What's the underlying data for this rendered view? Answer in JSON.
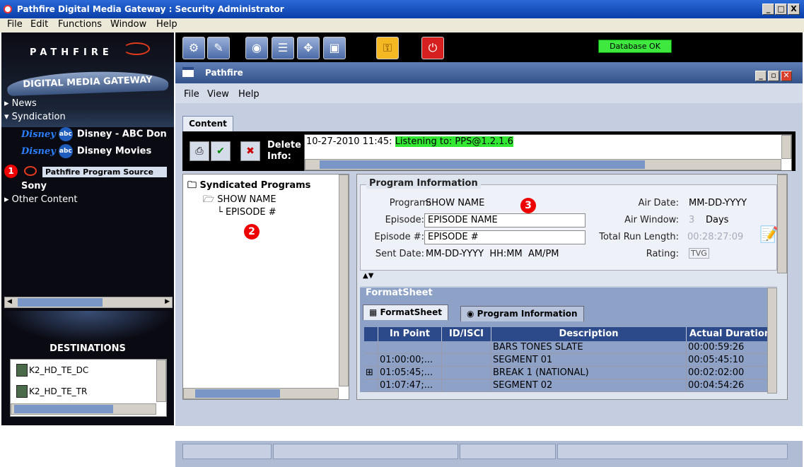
{
  "window": {
    "title": "Pathfire Digital Media Gateway : Security Administrator",
    "controls": [
      "_",
      "□",
      "X"
    ]
  },
  "menubar": [
    "File",
    "Edit",
    "Functions",
    "Window",
    "Help"
  ],
  "left": {
    "logo_text": "PATHFIRE",
    "logo_sub": "DIGITAL MEDIA GATEWAY",
    "tree": {
      "news": "News",
      "syndication": "Syndication",
      "networks": [
        {
          "label": "Disney - ABC Don",
          "badge_text": "Disney",
          "badge_abc": "abc"
        },
        {
          "label": "Disney Movies",
          "badge_text": "Disney",
          "badge_abc": "abc"
        }
      ],
      "selected": "Pathfire Program Source",
      "sony": "Sony",
      "other": "Other Content"
    },
    "badge1": "1",
    "destinations_title": "DESTINATIONS",
    "destinations": [
      "K2_HD_TE_DC",
      "K2_HD_TE_TR"
    ]
  },
  "toolbar": {
    "status": "Database OK",
    "icons": [
      "settings-icon",
      "wrench-icon",
      "binoculars-icon",
      "scroll-icon",
      "move-icon",
      "lock-icon",
      "key-icon",
      "power-icon"
    ]
  },
  "inner": {
    "title": "Pathfire",
    "menu": [
      "File",
      "View",
      "Help"
    ],
    "tab": "Content",
    "delete_label": "Delete Info:",
    "log": {
      "timestamp": "10-27-2010 11:45:",
      "message": "Listening to: PPS@1.2.1.6"
    },
    "tree": {
      "root": "Syndicated Programs",
      "show": "SHOW NAME",
      "episode": "EPISODE #"
    },
    "badge2": "2",
    "badge3": "3",
    "program_info": {
      "title": "Program Information",
      "program_label": "Program:",
      "program_value": "SHOW NAME",
      "episode_label": "Episode:",
      "episode_value": "EPISODE NAME",
      "episode_num_label": "Episode #:",
      "episode_num_value": "EPISODE #",
      "sent_label": "Sent Date:",
      "sent_value": "MM-DD-YYYY  HH:MM  AM/PM",
      "air_date_label": "Air Date:",
      "air_date_value": "MM-DD-YYYY",
      "air_window_label": "Air Window:",
      "air_window_value": "3",
      "air_window_unit": "Days",
      "run_length_label": "Total Run Length:",
      "run_length_value": "00:28:27:09",
      "rating_label": "Rating:",
      "rating_value": "TVG"
    },
    "formatsheet": {
      "title": "FormatSheet",
      "tabs": [
        "FormatSheet",
        "Program Information"
      ],
      "columns": [
        "In Point",
        "ID/ISCI",
        "Description",
        "Actual Duration"
      ],
      "rows": [
        {
          "expand": "",
          "in": "",
          "id": "",
          "desc": "BARS TONES SLATE",
          "dur": "00:00:59:26"
        },
        {
          "expand": "",
          "in": "01:00:00;...",
          "id": "",
          "desc": "SEGMENT 01",
          "dur": "00:05:45:10"
        },
        {
          "expand": "⊞",
          "in": "01:05:45;...",
          "id": "",
          "desc": "BREAK 1 (NATIONAL)",
          "dur": "00:02:02:00"
        },
        {
          "expand": "",
          "in": "01:07:47;...",
          "id": "",
          "desc": "SEGMENT 02",
          "dur": "00:04:54:26"
        }
      ]
    }
  }
}
